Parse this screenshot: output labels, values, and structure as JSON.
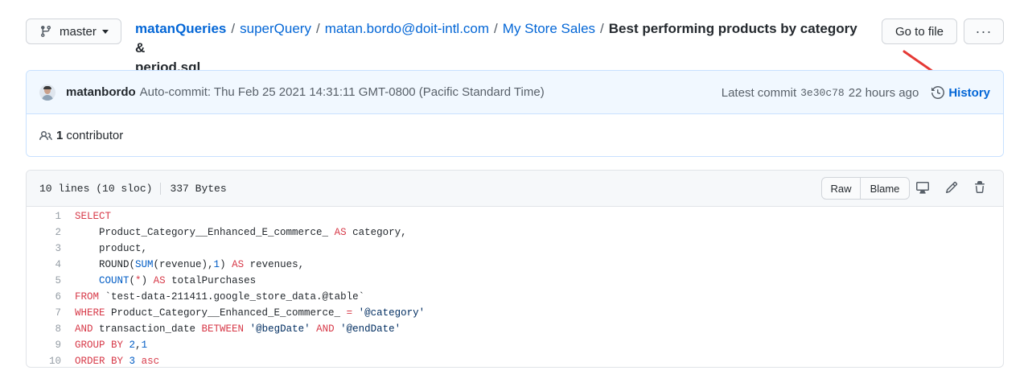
{
  "branch": {
    "label": "master"
  },
  "breadcrumb": {
    "owner": "matanQueries",
    "segments": [
      "superQuery",
      "matan.bordo@doit-intl.com",
      "My Store Sales"
    ],
    "separator": "/",
    "file_line1": "Best performing products by category &",
    "file_line2": "period.sql"
  },
  "actions": {
    "go_to_file": "Go to file",
    "more": "···"
  },
  "commit": {
    "author": "matanbordo",
    "message": "Auto-commit: Thu Feb 25 2021 14:31:11 GMT-0800 (Pacific Standard Time)",
    "latest_label": "Latest commit",
    "sha": "3e30c78",
    "time": "22 hours ago",
    "history_label": "History"
  },
  "contributors": {
    "count": "1",
    "label": "contributor"
  },
  "file": {
    "lines_info": "10 lines (10 sloc)",
    "size": "337 Bytes",
    "raw_label": "Raw",
    "blame_label": "Blame"
  },
  "code_lines": [
    {
      "num": "1",
      "tokens": [
        [
          "kw",
          "SELECT"
        ]
      ]
    },
    {
      "num": "2",
      "tokens": [
        [
          "",
          "    Product_Category__Enhanced_E_commerce_ "
        ],
        [
          "kw",
          "AS"
        ],
        [
          "",
          " category,"
        ]
      ]
    },
    {
      "num": "3",
      "tokens": [
        [
          "",
          "    product,"
        ]
      ]
    },
    {
      "num": "4",
      "tokens": [
        [
          "",
          "    ROUND("
        ],
        [
          "fn",
          "SUM"
        ],
        [
          "",
          "(revenue),"
        ],
        [
          "fn",
          "1"
        ],
        [
          "",
          ") "
        ],
        [
          "kw",
          "AS"
        ],
        [
          "",
          " revenues,"
        ]
      ]
    },
    {
      "num": "5",
      "tokens": [
        [
          "",
          "    "
        ],
        [
          "fn",
          "COUNT"
        ],
        [
          "",
          "("
        ],
        [
          "kw",
          "*"
        ],
        [
          "",
          ") "
        ],
        [
          "kw",
          "AS"
        ],
        [
          "",
          " totalPurchases"
        ]
      ]
    },
    {
      "num": "6",
      "tokens": [
        [
          "kw",
          "FROM"
        ],
        [
          "",
          " `test-data-211411.google_store_data.@table`"
        ]
      ]
    },
    {
      "num": "7",
      "tokens": [
        [
          "kw",
          "WHERE"
        ],
        [
          "",
          " Product_Category__Enhanced_E_commerce_ "
        ],
        [
          "kw",
          "="
        ],
        [
          "str",
          " '@category'"
        ]
      ]
    },
    {
      "num": "8",
      "tokens": [
        [
          "kw",
          "AND"
        ],
        [
          "",
          " transaction_date "
        ],
        [
          "kw",
          "BETWEEN"
        ],
        [
          "str",
          " '@begDate'"
        ],
        [
          "",
          " "
        ],
        [
          "kw",
          "AND"
        ],
        [
          "str",
          " '@endDate'"
        ]
      ]
    },
    {
      "num": "9",
      "tokens": [
        [
          "kw",
          "GROUP BY"
        ],
        [
          "",
          " "
        ],
        [
          "fn",
          "2"
        ],
        [
          "",
          ","
        ],
        [
          "fn",
          "1"
        ]
      ]
    },
    {
      "num": "10",
      "tokens": [
        [
          "kw",
          "ORDER BY"
        ],
        [
          "",
          " "
        ],
        [
          "fn",
          "3"
        ],
        [
          "",
          " "
        ],
        [
          "kw",
          "asc"
        ]
      ]
    }
  ],
  "colors": {
    "link": "#0366d6",
    "keyword": "#d73a49",
    "constant": "#005cc5",
    "string": "#032f62",
    "arrow": "#e53935"
  },
  "icons": [
    "git-branch-icon",
    "caret-down-icon",
    "kebab-icon",
    "history-clock-icon",
    "people-icon",
    "desktop-icon",
    "pencil-icon",
    "trash-icon",
    "red-arrow-annotation"
  ]
}
